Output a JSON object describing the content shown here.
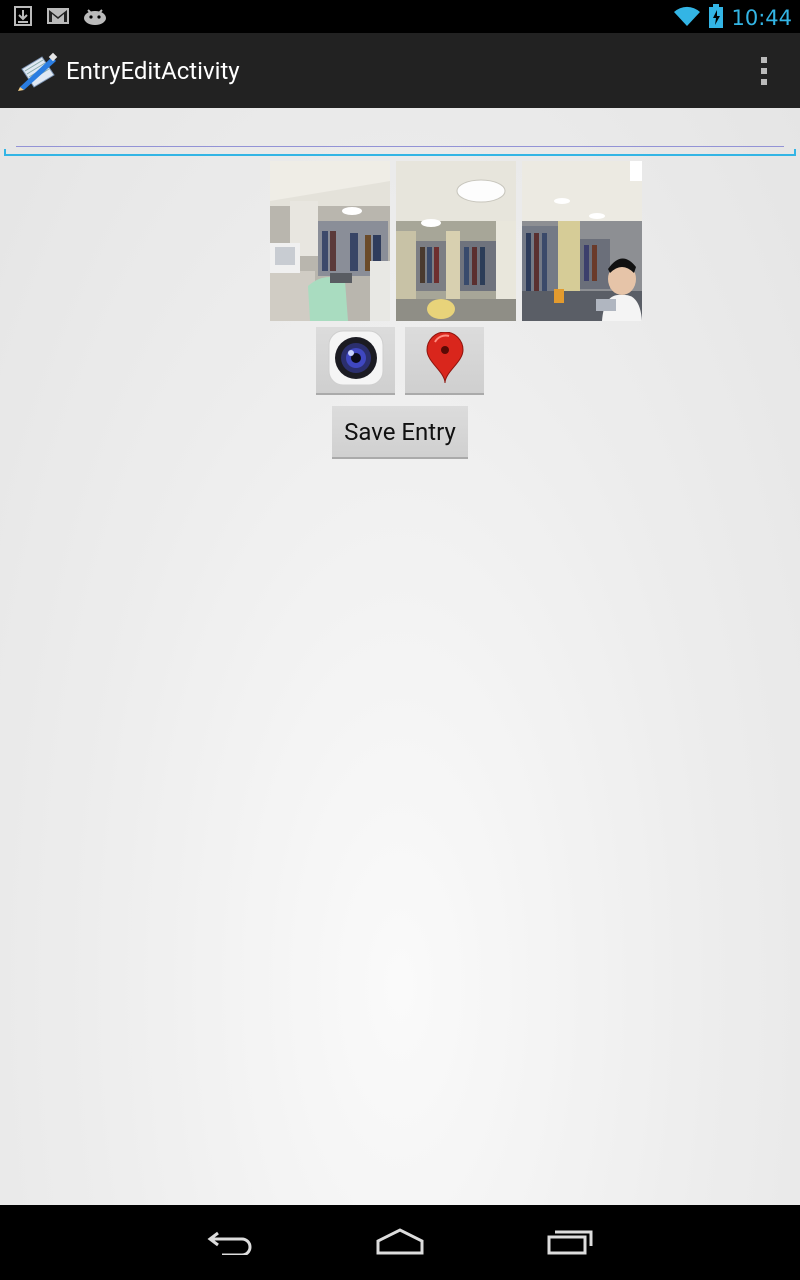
{
  "status_bar": {
    "time": "10:44",
    "icons": [
      "download-icon",
      "gmail-icon",
      "android-icon",
      "wifi-icon",
      "battery-charging-icon"
    ]
  },
  "action_bar": {
    "title": "EntryEditActivity",
    "app_icon": "notebook-pen-icon",
    "overflow_icon": "overflow-menu-icon"
  },
  "entry_field": {
    "value": "",
    "placeholder": ""
  },
  "photos": [
    {
      "name": "library-photo-1"
    },
    {
      "name": "library-photo-2"
    },
    {
      "name": "library-photo-3"
    }
  ],
  "buttons": {
    "camera_icon": "camera-icon",
    "location_icon": "map-pin-icon",
    "save_label": "Save Entry"
  },
  "nav_bar": {
    "icons": [
      "back-icon",
      "home-icon",
      "recents-icon"
    ]
  }
}
